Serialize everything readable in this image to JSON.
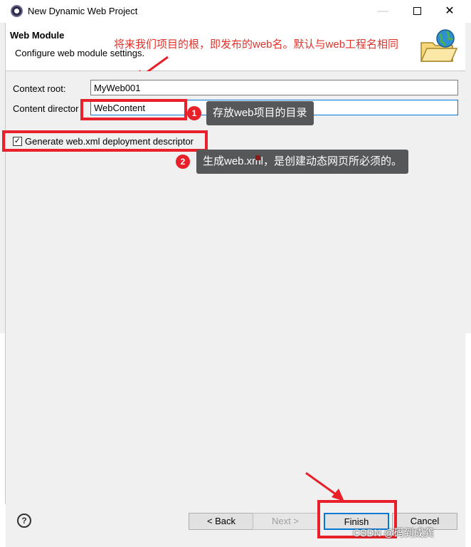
{
  "window": {
    "title": "New Dynamic Web Project",
    "minimize_glyph": "—",
    "close_glyph": "✕"
  },
  "banner": {
    "title": "Web Module",
    "description": "Configure web module settings.",
    "annotation": "将来我们项目的根，即发布的web名。默认与web工程名相同"
  },
  "form": {
    "context_root_label": "Context root:",
    "context_root_value": "MyWeb001",
    "content_dir_label": "Content director",
    "content_dir_suffix": ":",
    "content_dir_value": "WebContent",
    "generate_label": "Generate web.xml deployment descriptor",
    "generate_checked": true,
    "check_glyph": "✓"
  },
  "annotations": {
    "badge1": "1",
    "tip1": "存放web项目的目录",
    "badge2": "2",
    "tip2": "生成web.xml，是创建动态网页所必须的。",
    "accent_color": "#e8202a"
  },
  "buttons": {
    "help_glyph": "?",
    "back": "< Back",
    "next": "Next >",
    "finish": "Finish",
    "cancel": "Cancel"
  },
  "watermark": "CSDN @码到成龚"
}
